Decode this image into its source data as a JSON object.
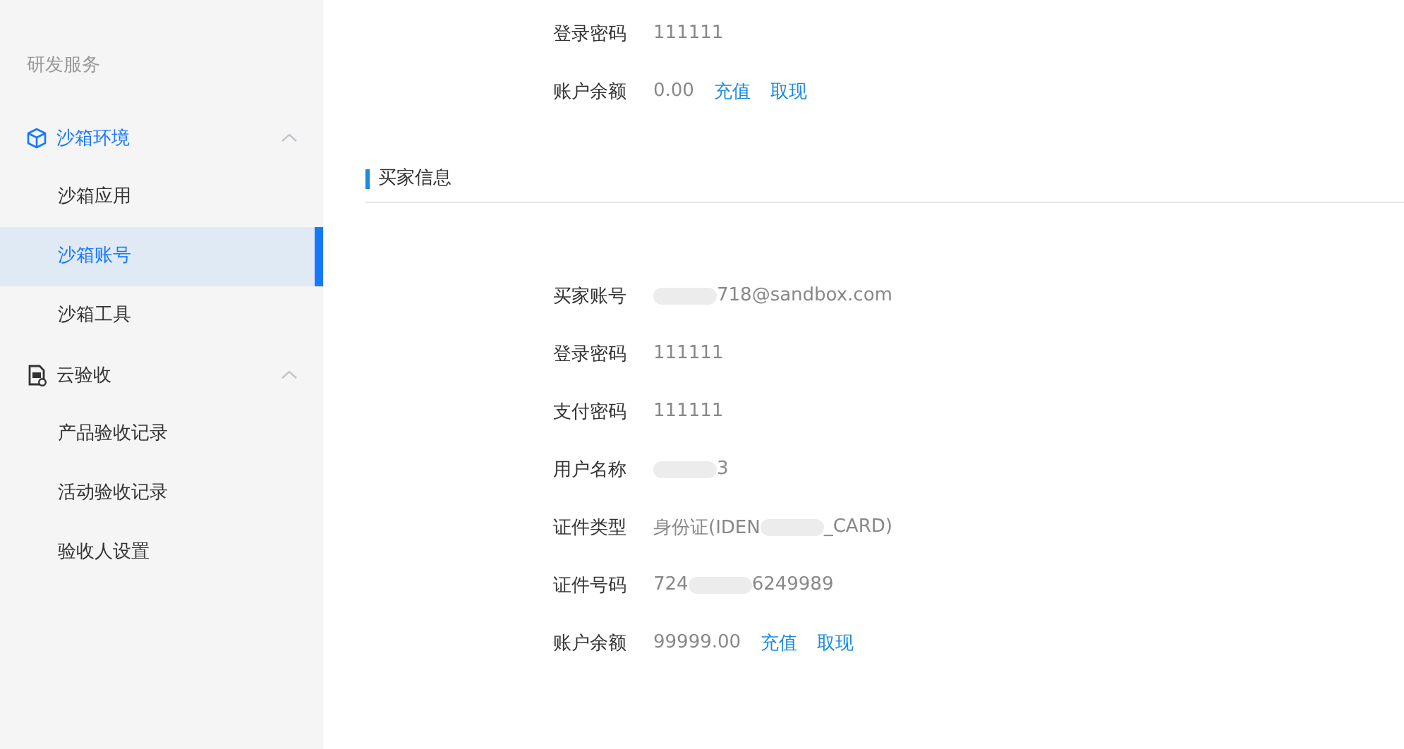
{
  "sidebar": {
    "heading": "研发服务",
    "groups": [
      {
        "label": "沙箱环境",
        "kind": "cube",
        "active": true,
        "expanded": true,
        "items": [
          {
            "label": "沙箱应用",
            "selected": false
          },
          {
            "label": "沙箱账号",
            "selected": true
          },
          {
            "label": "沙箱工具",
            "selected": false
          }
        ]
      },
      {
        "label": "云验收",
        "kind": "document",
        "active": false,
        "expanded": true,
        "items": [
          {
            "label": "产品验收记录",
            "selected": false
          },
          {
            "label": "活动验收记录",
            "selected": false
          },
          {
            "label": "验收人设置",
            "selected": false
          }
        ]
      }
    ]
  },
  "seller_rows": [
    {
      "label": "登录密码",
      "segments": [
        {
          "kind": "text",
          "text": "111111"
        }
      ]
    },
    {
      "label": "账户余额",
      "segments": [
        {
          "kind": "text",
          "text": "0.00"
        }
      ],
      "links": [
        "充值",
        "取现"
      ]
    }
  ],
  "buyer_section": {
    "title": "买家信息",
    "rows": [
      {
        "label": "买家账号",
        "segments": [
          {
            "kind": "smear"
          },
          {
            "kind": "text",
            "text": "718@sandbox.com"
          }
        ]
      },
      {
        "label": "登录密码",
        "segments": [
          {
            "kind": "text",
            "text": "111111"
          }
        ]
      },
      {
        "label": "支付密码",
        "segments": [
          {
            "kind": "text",
            "text": "111111"
          }
        ]
      },
      {
        "label": "用户名称",
        "segments": [
          {
            "kind": "smear"
          },
          {
            "kind": "text",
            "text": "3"
          }
        ]
      },
      {
        "label": "证件类型",
        "segments": [
          {
            "kind": "text",
            "text": "身份证(IDEN"
          },
          {
            "kind": "smear"
          },
          {
            "kind": "text",
            "text": "_CARD)"
          }
        ]
      },
      {
        "label": "证件号码",
        "segments": [
          {
            "kind": "text",
            "text": "724"
          },
          {
            "kind": "smear"
          },
          {
            "kind": "text",
            "text": "6249989"
          }
        ]
      },
      {
        "label": "账户余额",
        "segments": [
          {
            "kind": "text",
            "text": "99999.00"
          }
        ],
        "links": [
          "充值",
          "取现"
        ]
      }
    ]
  }
}
